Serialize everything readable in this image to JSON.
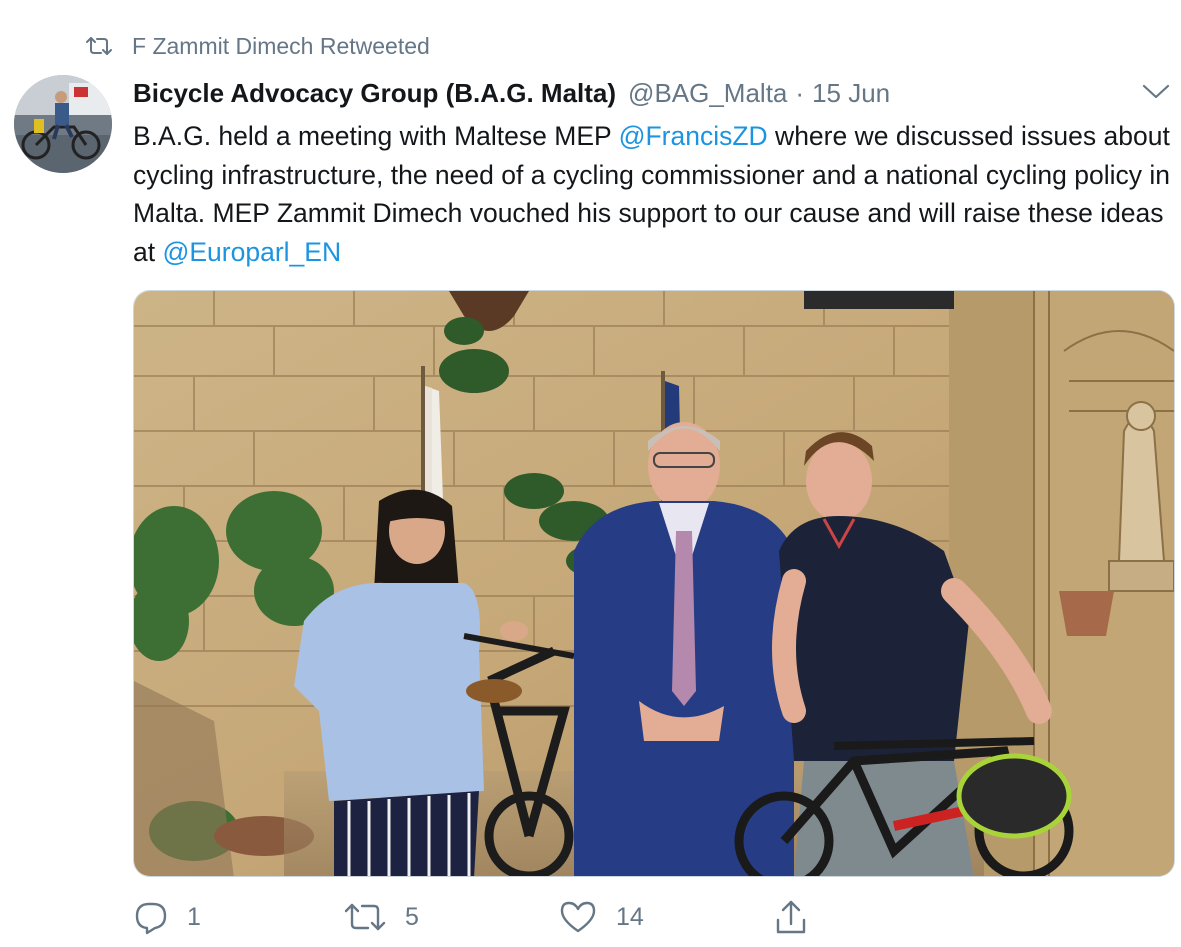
{
  "retweet_context": {
    "icon": "retweet-icon",
    "text": "F Zammit Dimech Retweeted"
  },
  "author": {
    "display_name": "Bicycle Advocacy Group (B.A.G. Malta)",
    "handle": "@BAG_Malta",
    "separator": "·",
    "date": "15 Jun"
  },
  "tweet": {
    "text_1": "B.A.G. held a meeting with Maltese MEP ",
    "mention_1": "@FrancisZD",
    "text_2": " where we discussed issues about cycling infrastructure, the need of a cycling commissioner and a national cycling policy in Malta.  MEP Zammit Dimech vouched his support to our cause and will raise these ideas at ",
    "mention_2": "@Europarl_EN"
  },
  "actions": {
    "reply": {
      "icon": "reply-icon",
      "count": "1"
    },
    "retweet": {
      "icon": "retweet-icon",
      "count": "5"
    },
    "like": {
      "icon": "heart-icon",
      "count": "14"
    },
    "share": {
      "icon": "share-icon"
    }
  },
  "colors": {
    "text_primary": "#14171a",
    "text_secondary": "#657786",
    "link": "#1b95e0",
    "border": "#ccd6dd"
  }
}
